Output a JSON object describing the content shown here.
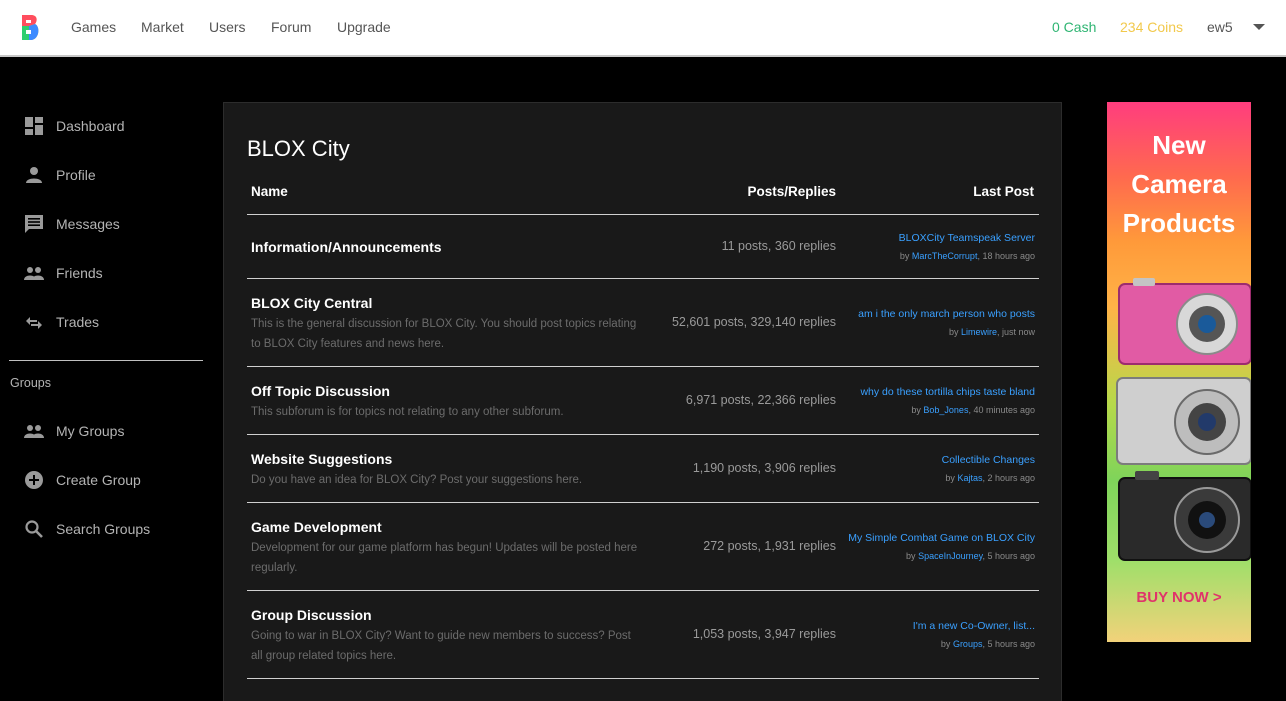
{
  "nav": {
    "links": [
      "Games",
      "Market",
      "Users",
      "Forum",
      "Upgrade"
    ],
    "cash": "0 Cash",
    "coins": "234 Coins",
    "username": "ew5",
    "colors": {
      "cash": "#2fb573",
      "coins": "#f2c94c"
    }
  },
  "sidebar": {
    "items": [
      {
        "label": "Dashboard",
        "icon": "dashboard-icon"
      },
      {
        "label": "Profile",
        "icon": "person-icon"
      },
      {
        "label": "Messages",
        "icon": "message-icon"
      },
      {
        "label": "Friends",
        "icon": "people-icon"
      },
      {
        "label": "Trades",
        "icon": "swap-icon"
      }
    ],
    "groups_heading": "Groups",
    "group_items": [
      {
        "label": "My Groups",
        "icon": "people-icon"
      },
      {
        "label": "Create Group",
        "icon": "add-circle-icon"
      },
      {
        "label": "Search Groups",
        "icon": "search-icon"
      }
    ]
  },
  "forum": {
    "title": "BLOX City",
    "columns": {
      "name": "Name",
      "posts": "Posts/Replies",
      "last": "Last Post"
    },
    "rows": [
      {
        "name": "Information/Announcements",
        "desc": "",
        "stats": "11 posts, 360 replies",
        "last_title": "BLOXCity Teamspeak Server",
        "last_user": "MarcTheCorrupt",
        "last_time": ", 18 hours ago"
      },
      {
        "name": "BLOX City Central",
        "desc": "This is the general discussion for BLOX City. You should post topics relating to BLOX City features and news here.",
        "stats": "52,601 posts, 329,140 replies",
        "last_title": "am i the only march person who posts",
        "last_user": "Limewire",
        "last_time": ", just now"
      },
      {
        "name": "Off Topic Discussion",
        "desc": "This subforum is for topics not relating to any other subforum.",
        "stats": "6,971 posts, 22,366 replies",
        "last_title": "why do these tortilla chips taste bland",
        "last_user": "Bob_Jones",
        "last_time": ", 40 minutes ago"
      },
      {
        "name": "Website Suggestions",
        "desc": "Do you have an idea for BLOX City? Post your suggestions here.",
        "stats": "1,190 posts, 3,906 replies",
        "last_title": "Collectible Changes",
        "last_user": "Kajtas",
        "last_time": ", 2 hours ago"
      },
      {
        "name": "Game Development",
        "desc": "Development for our game platform has begun! Updates will be posted here regularly.",
        "stats": "272 posts, 1,931 replies",
        "last_title": "My Simple Combat Game on BLOX City",
        "last_user": "SpaceInJourney",
        "last_time": ", 5 hours ago"
      },
      {
        "name": "Group Discussion",
        "desc": "Going to war in BLOX City? Want to guide new members to success? Post all group related topics here.",
        "stats": "1,053 posts, 3,947 replies",
        "last_title": "I'm a new Co-Owner, list...",
        "last_user": "Groups",
        "last_time": ", 5 hours ago"
      }
    ],
    "by_prefix": "by "
  },
  "ad": {
    "headline": [
      "New",
      "Camera",
      "Products"
    ],
    "cta": "BUY NOW >"
  }
}
